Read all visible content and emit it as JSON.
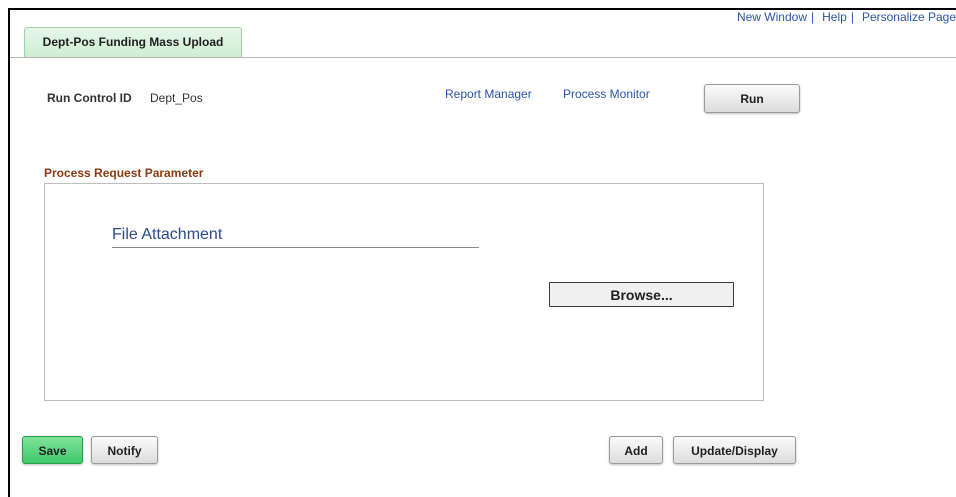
{
  "header": {
    "links": [
      "New Window",
      "Help",
      "Personalize Page"
    ]
  },
  "tab": {
    "label": "Dept-Pos Funding Mass Upload"
  },
  "run_control": {
    "label": "Run Control ID",
    "value": "Dept_Pos"
  },
  "process_links": {
    "report_manager": "Report Manager",
    "process_monitor": "Process Monitor"
  },
  "run_button": "Run",
  "parameters": {
    "section_title": "Process Request Parameter",
    "file_attachment_label": "File Attachment",
    "browse_button": "Browse..."
  },
  "footer": {
    "save": "Save",
    "notify": "Notify",
    "add": "Add",
    "update_display": "Update/Display"
  },
  "colors": {
    "link": "#2a55a8",
    "section_title": "#8a3b12",
    "save_button": "#3fc86a",
    "tab_background": "#cdeed2"
  }
}
